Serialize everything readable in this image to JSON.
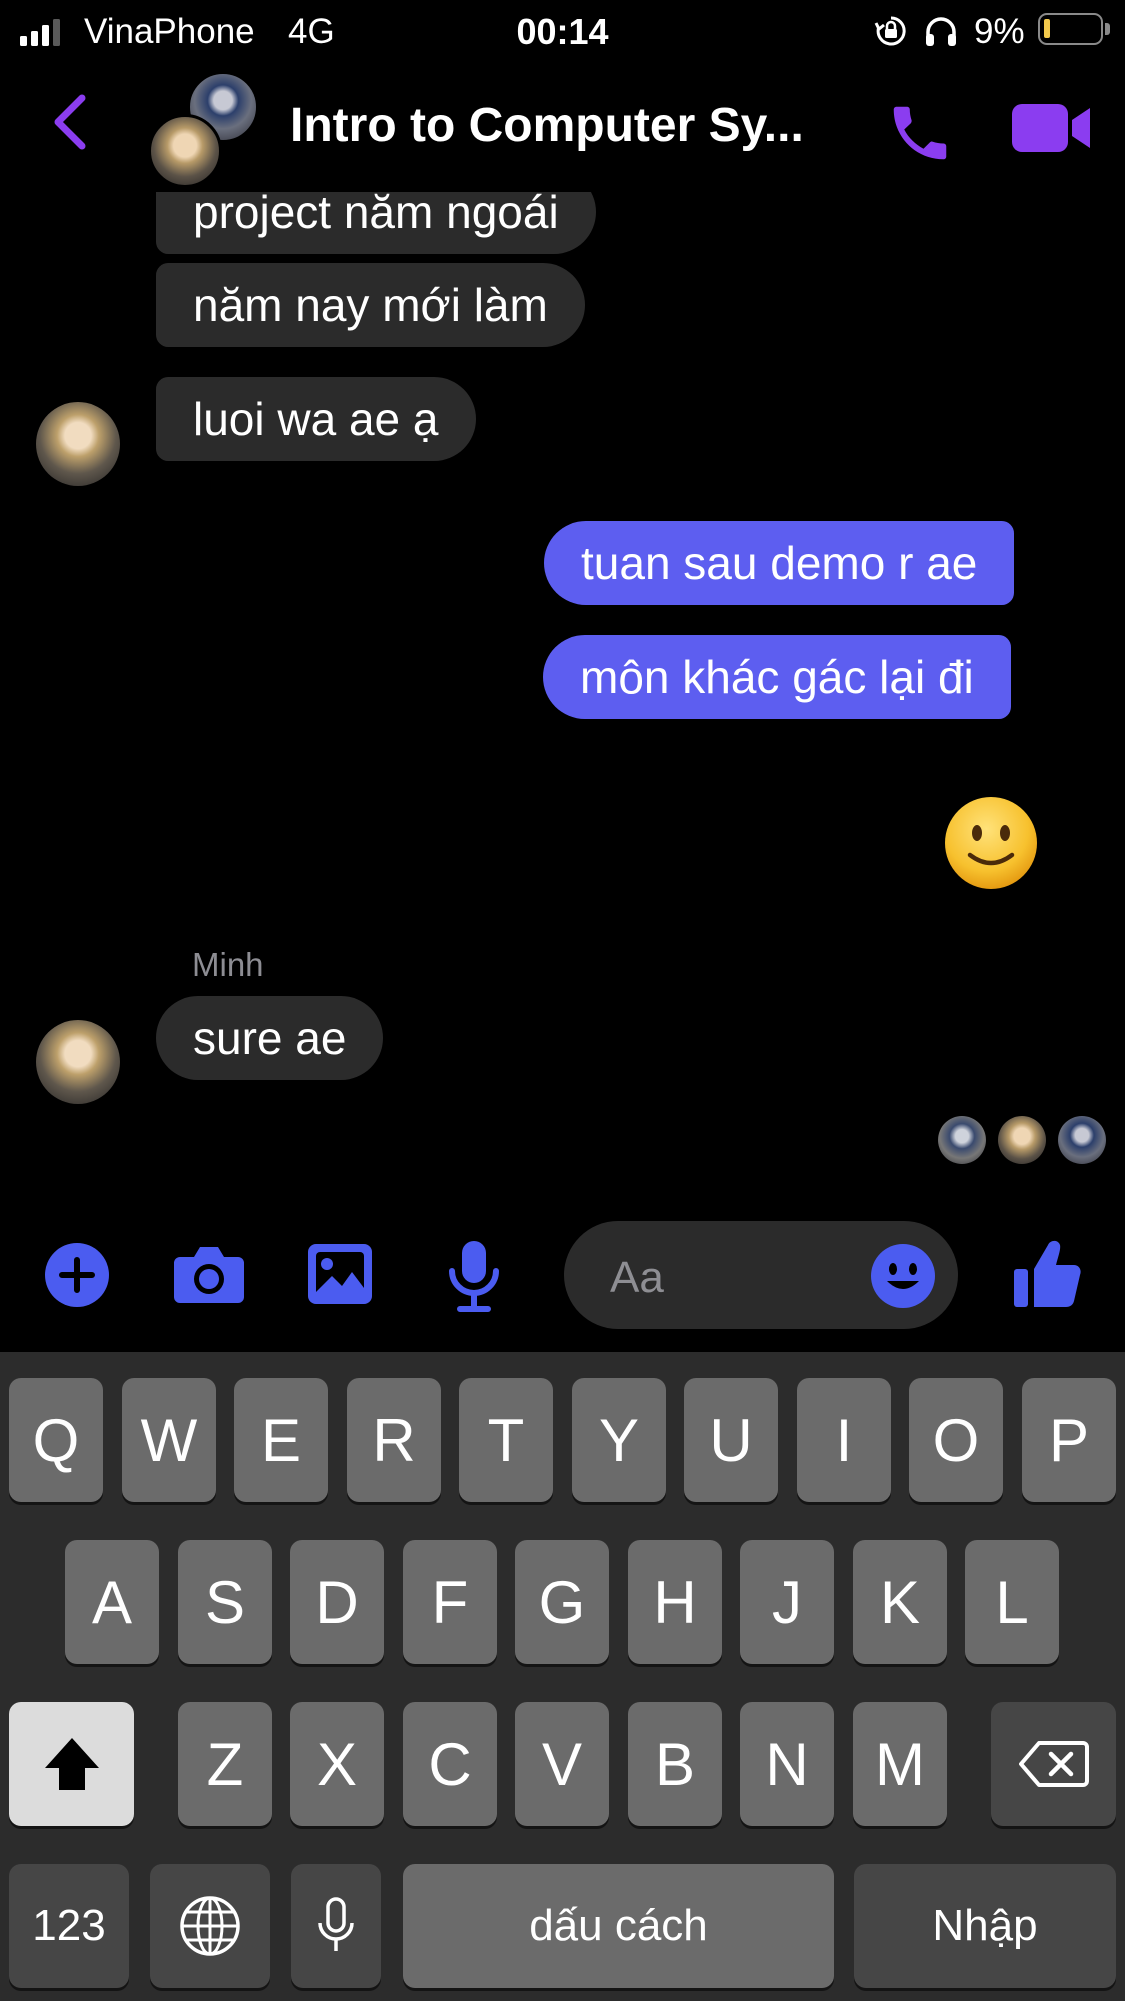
{
  "status_bar": {
    "carrier": "VinaPhone",
    "network": "4G",
    "time": "00:14",
    "battery_percent": "9%",
    "battery_level": 0.09
  },
  "header": {
    "title": "Intro to Computer Sy...",
    "accent_color": "#8b3df0"
  },
  "messages": {
    "items": [
      {
        "direction": "incoming",
        "text": "project năm ngoái"
      },
      {
        "direction": "incoming",
        "text": "năm nay mới làm"
      },
      {
        "direction": "incoming",
        "text": "luoi wa ae ạ"
      },
      {
        "direction": "outgoing",
        "text": "tuan sau demo r ae"
      },
      {
        "direction": "outgoing",
        "text": "môn khác gác lại đi"
      },
      {
        "direction": "outgoing",
        "emoji": "slightly-smiling-face"
      },
      {
        "direction": "incoming",
        "sender": "Minh",
        "text": "sure ae"
      }
    ],
    "bubble_in_color": "#2b2b2b",
    "bubble_out_color": "#5d5ef0"
  },
  "composer": {
    "placeholder": "Aa",
    "icon_color": "#4b5cf0"
  },
  "keyboard": {
    "row1": [
      "Q",
      "W",
      "E",
      "R",
      "T",
      "Y",
      "U",
      "I",
      "O",
      "P"
    ],
    "row2": [
      "A",
      "S",
      "D",
      "F",
      "G",
      "H",
      "J",
      "K",
      "L"
    ],
    "row3": [
      "Z",
      "X",
      "C",
      "V",
      "B",
      "N",
      "M"
    ],
    "numbers_label": "123",
    "space_label": "dấu cách",
    "return_label": "Nhập"
  }
}
